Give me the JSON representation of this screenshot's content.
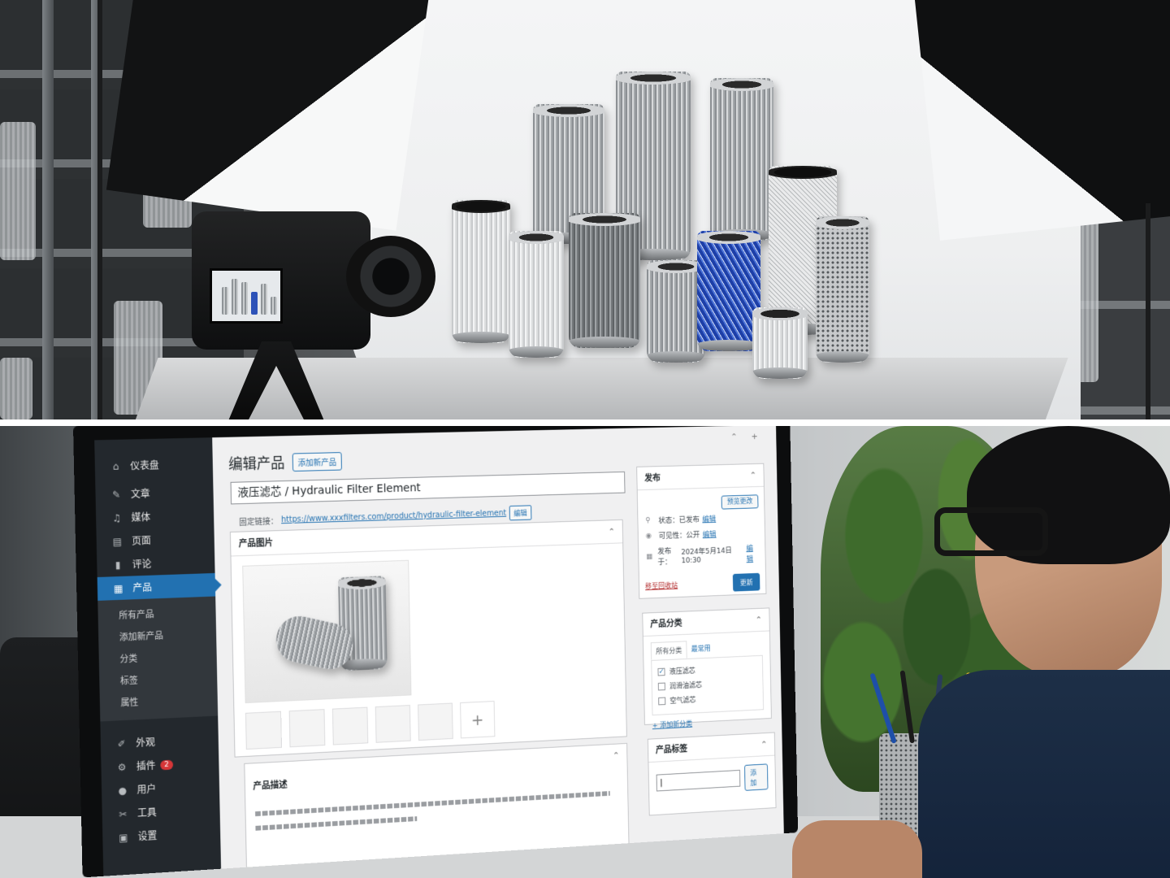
{
  "wp_admin": {
    "sidebar": {
      "items": [
        {
          "label": "仪表盘",
          "icon": "dashboard-icon"
        },
        {
          "label": "文章",
          "icon": "pin-icon"
        },
        {
          "label": "媒体",
          "icon": "media-icon"
        },
        {
          "label": "页面",
          "icon": "page-icon"
        },
        {
          "label": "评论",
          "icon": "comment-icon"
        },
        {
          "label": "产品",
          "icon": "product-icon",
          "active": true
        },
        {
          "label": "外观",
          "icon": "brush-icon"
        },
        {
          "label": "插件",
          "icon": "plugin-icon",
          "badge": "2"
        },
        {
          "label": "用户",
          "icon": "user-icon"
        },
        {
          "label": "工具",
          "icon": "wrench-icon"
        },
        {
          "label": "设置",
          "icon": "settings-icon"
        }
      ],
      "submenu": [
        "所有产品",
        "添加新产品",
        "分类",
        "标签",
        "属性"
      ]
    },
    "page": {
      "title": "编辑产品",
      "add_new": "添加新产品",
      "product_title": "液压滤芯 / Hydraulic Filter Element",
      "permalink_label": "固定链接：",
      "permalink_url": "https://www.xxxfilters.com/product/hydraulic-filter-element",
      "permalink_edit": "编辑"
    },
    "product_images": {
      "heading": "产品图片",
      "add_symbol": "+"
    },
    "publish": {
      "heading": "发布",
      "preview": "预览更改",
      "status_label": "状态：",
      "status_value": "已发布",
      "visibility_label": "可见性：",
      "visibility_value": "公开",
      "published_label": "发布于：",
      "published_value": "2024年5月14日 10:30",
      "edit_link": "编辑",
      "trash": "移至回收站",
      "update": "更新"
    },
    "categories": {
      "heading": "产品分类",
      "tab_all": "所有分类",
      "tab_popular": "最常用",
      "items": [
        {
          "label": "液压滤芯",
          "checked": true
        },
        {
          "label": "润滑油滤芯",
          "checked": false
        },
        {
          "label": "空气滤芯",
          "checked": false
        }
      ],
      "add_new": "+ 添加新分类"
    },
    "description": {
      "heading": "产品描述"
    },
    "tags": {
      "heading": "产品标签",
      "add_button": "添加",
      "input_value": "|"
    },
    "accent_color": "#2271b1",
    "sidebar_color": "#23282d"
  }
}
